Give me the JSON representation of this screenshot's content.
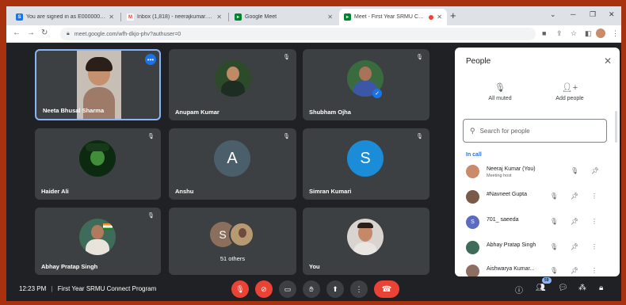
{
  "browser": {
    "tabs": [
      {
        "title": "You are signed in as E0000002511",
        "icon": "s-app-icon",
        "color": "#1a73e8",
        "active": false
      },
      {
        "title": "Inbox (1,818) - neerajkumar.cs01@",
        "icon": "gmail-icon",
        "color": "#ea4335",
        "active": false
      },
      {
        "title": "Google Meet",
        "icon": "meet-icon",
        "color": "#f9ab00",
        "active": false
      },
      {
        "title": "Meet - First Year SRMU Con...",
        "icon": "meet-icon",
        "color": "#00832d",
        "active": true
      }
    ],
    "url": "meet.google.com/wfh-dkjo-phv?authuser=0"
  },
  "tiles": [
    {
      "name": "Neeta Bhusal Sharma",
      "type": "video",
      "highlighted": true
    },
    {
      "name": "Anupam Kumar",
      "type": "photo",
      "color": "#2d4a2b"
    },
    {
      "name": "Shubham Ojha",
      "type": "photo",
      "color": "#3a6b3e"
    },
    {
      "name": "Haider Ali",
      "type": "photo",
      "color": "#0b2a10"
    },
    {
      "name": "Anshu",
      "type": "letter",
      "letter": "A",
      "color": "#4b5f6b"
    },
    {
      "name": "Simran Kumari",
      "type": "letter",
      "letter": "S",
      "color": "#1a8cd8"
    },
    {
      "name": "Abhay Pratap Singh",
      "type": "photo",
      "color": "#3e6b5a"
    },
    {
      "name": "51 others",
      "type": "others",
      "letter": "S",
      "color": "#8b6f5c"
    },
    {
      "name": "You",
      "type": "photo",
      "color": "#d9d4cf"
    }
  ],
  "people_panel": {
    "title": "People",
    "all_muted": "All muted",
    "add_people": "Add people",
    "search_placeholder": "Search for people",
    "section": "In call",
    "participants": [
      {
        "name": "Neeraj Kumar (You)",
        "sub": "Meeting host",
        "color": "#c98b6a"
      },
      {
        "name": "#Navneet Gupta",
        "sub": "",
        "color": "#7a5b4a"
      },
      {
        "name": "701_ saeeda",
        "sub": "",
        "color": "#5c6bc0",
        "letter": "S"
      },
      {
        "name": "Abhay Pratap Singh",
        "sub": "",
        "color": "#3e6b5a"
      },
      {
        "name": "Aishwarya Kumar...",
        "sub": "",
        "color": "#8d6e63"
      }
    ]
  },
  "bottom": {
    "time": "12:23 PM",
    "separator": "|",
    "meeting": "First Year SRMU Connect Program",
    "people_count": "59"
  }
}
